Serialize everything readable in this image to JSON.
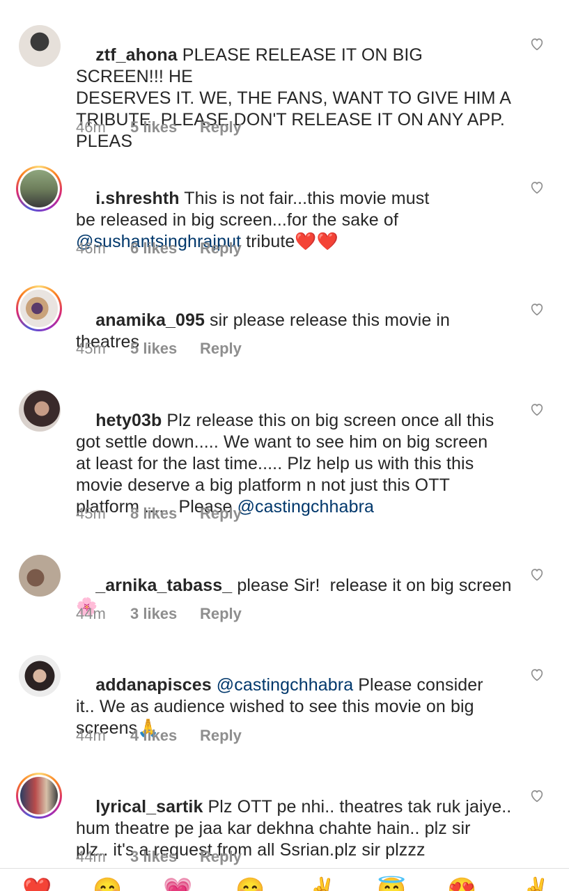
{
  "comments": [
    {
      "username": "ztf_ahona",
      "pre": " PLEASE RELEASE IT ON BIG SCREEN!!! HE\nDESERVES IT. WE, THE FANS, WANT TO GIVE HIM A\nTRIBUTE. PLEASE DON'T RELEASE IT ON ANY APP.\nPLEAS",
      "mention": "",
      "post": "",
      "time": "46m",
      "likes": "5 likes",
      "reply": "Reply"
    },
    {
      "username": "i.shreshth",
      "pre": " This is not fair...this movie must\nbe released in big screen...for the sake of\n",
      "mention": "@sushantsinghrajput",
      "post": " tribute❤️❤️",
      "time": "46m",
      "likes": "6 likes",
      "reply": "Reply"
    },
    {
      "username": "anamika_095",
      "pre": " sir please release this movie in\ntheatres",
      "mention": "",
      "post": "",
      "time": "45m",
      "likes": "5 likes",
      "reply": "Reply"
    },
    {
      "username": "hety03b",
      "pre": " Plz release this on big screen once all this\ngot settle down..... We want to see him on big screen\nat least for the last time..... Plz help us with this this\nmovie deserve a big platform n not just this OTT\nplatform ...... Please ",
      "mention": "@castingchhabra",
      "post": "",
      "time": "45m",
      "likes": "8 likes",
      "reply": "Reply"
    },
    {
      "username": "_arnika_tabass_",
      "pre": " please Sir!  release it on big screen\n🌸",
      "mention": "",
      "post": "",
      "time": "44m",
      "likes": "3 likes",
      "reply": "Reply"
    },
    {
      "username": "addanapisces",
      "pre": " ",
      "mention": "@castingchhabra",
      "post": " Please consider\nit.. We as audience wished to see this movie on big\nscreens🙏",
      "time": "44m",
      "likes": "4 likes",
      "reply": "Reply"
    },
    {
      "username": "lyrical_sartik",
      "pre": " Plz OTT pe nhi.. theatres tak ruk jaiye..\nhum theatre pe jaa kar dekhna chahte hain.. plz sir\nplz.. it's a request from all Ssrian.plz sir plzzz",
      "mention": "",
      "post": "",
      "time": "44m",
      "likes": "3 likes",
      "reply": "Reply"
    }
  ],
  "emoji_bar": [
    "❤️",
    "😊",
    "💗",
    "😊",
    "✌️",
    "😇",
    "😍",
    "✌️"
  ],
  "icons": {
    "like": "heart-outline-icon"
  }
}
